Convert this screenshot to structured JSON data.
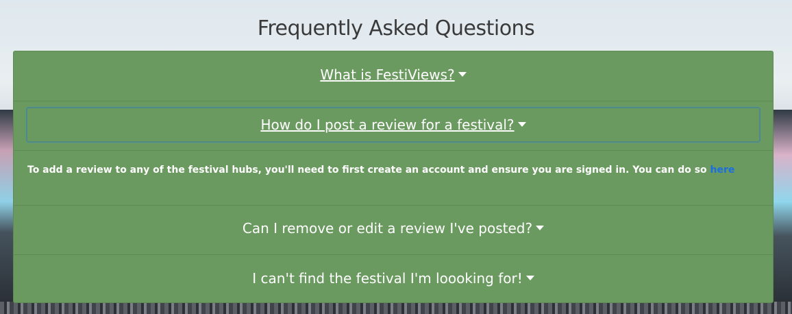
{
  "page": {
    "title": "Frequently Asked Questions"
  },
  "faq": {
    "items": [
      {
        "question": "What is FestiViews?",
        "expanded": false
      },
      {
        "question": "How do I post a review for a festival?",
        "expanded": true,
        "answer": "To add a review to any of the festival hubs, you'll need to first create an account and ensure you are signed in. You can do so ",
        "answer_link": "here"
      },
      {
        "question": "Can I remove or edit a review I've posted?",
        "expanded": false
      },
      {
        "question": "I can't find the festival I'm loooking for!",
        "expanded": false
      }
    ]
  },
  "colors": {
    "accordion_bg": "#6b9a60",
    "link": "#1a6fe0",
    "title_text": "#3a3a3a"
  }
}
